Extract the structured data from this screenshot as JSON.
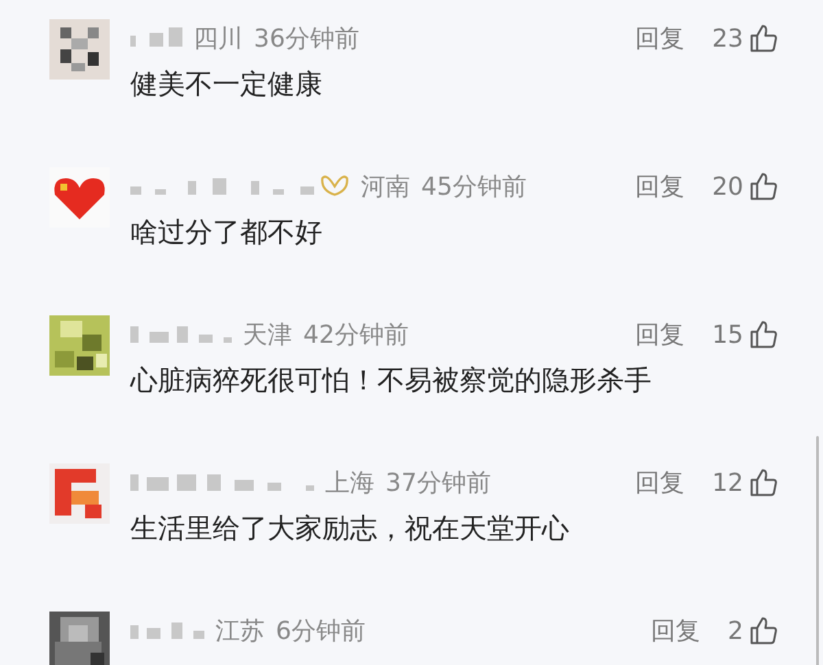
{
  "comments": [
    {
      "region": "四川",
      "time": "36分钟前",
      "reply": "回复",
      "likes": "23",
      "badge": false,
      "text": "健美不一定健康"
    },
    {
      "region": "河南",
      "time": "45分钟前",
      "reply": "回复",
      "likes": "20",
      "badge": true,
      "text": "啥过分了都不好"
    },
    {
      "region": "天津",
      "time": "42分钟前",
      "reply": "回复",
      "likes": "15",
      "badge": false,
      "text": "心脏病猝死很可怕！不易被察觉的隐形杀手"
    },
    {
      "region": "上海",
      "time": "37分钟前",
      "reply": "回复",
      "likes": "12",
      "badge": false,
      "text": "生活里给了大家励志，祝在天堂开心"
    },
    {
      "region": "江苏",
      "time": "6分钟前",
      "reply": "回复",
      "likes": "2",
      "badge": false
    }
  ]
}
